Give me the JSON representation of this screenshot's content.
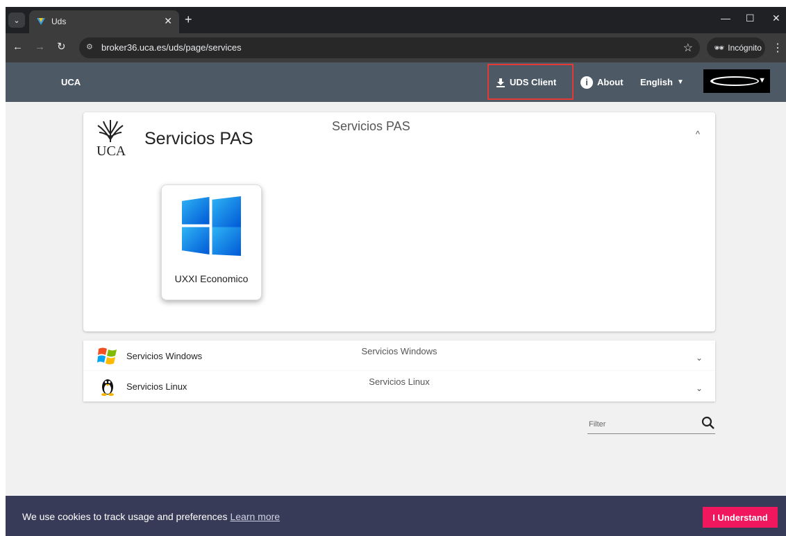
{
  "browser": {
    "tab_title": "Uds",
    "url": "broker36.uca.es/uds/page/services",
    "incognito_label": "Incógnito"
  },
  "appbar": {
    "brand": "UCA",
    "uds_client": "UDS Client",
    "about": "About",
    "language": "English"
  },
  "group": {
    "logo_text": "UCA",
    "title": "Servicios PAS",
    "center_title": "Servicios PAS",
    "services": [
      {
        "name": "UXXI Economico",
        "icon": "windows-11-icon"
      }
    ]
  },
  "accordions": [
    {
      "label": "Servicios Windows",
      "center": "Servicios Windows",
      "icon": "windows-xp-icon"
    },
    {
      "label": "Servicios Linux",
      "center": "Servicios Linux",
      "icon": "tux-icon"
    }
  ],
  "filter": {
    "placeholder": "Filter"
  },
  "cookie": {
    "message": "We use cookies to track usage and preferences",
    "learn_more": "Learn more",
    "button": "I Understand"
  }
}
